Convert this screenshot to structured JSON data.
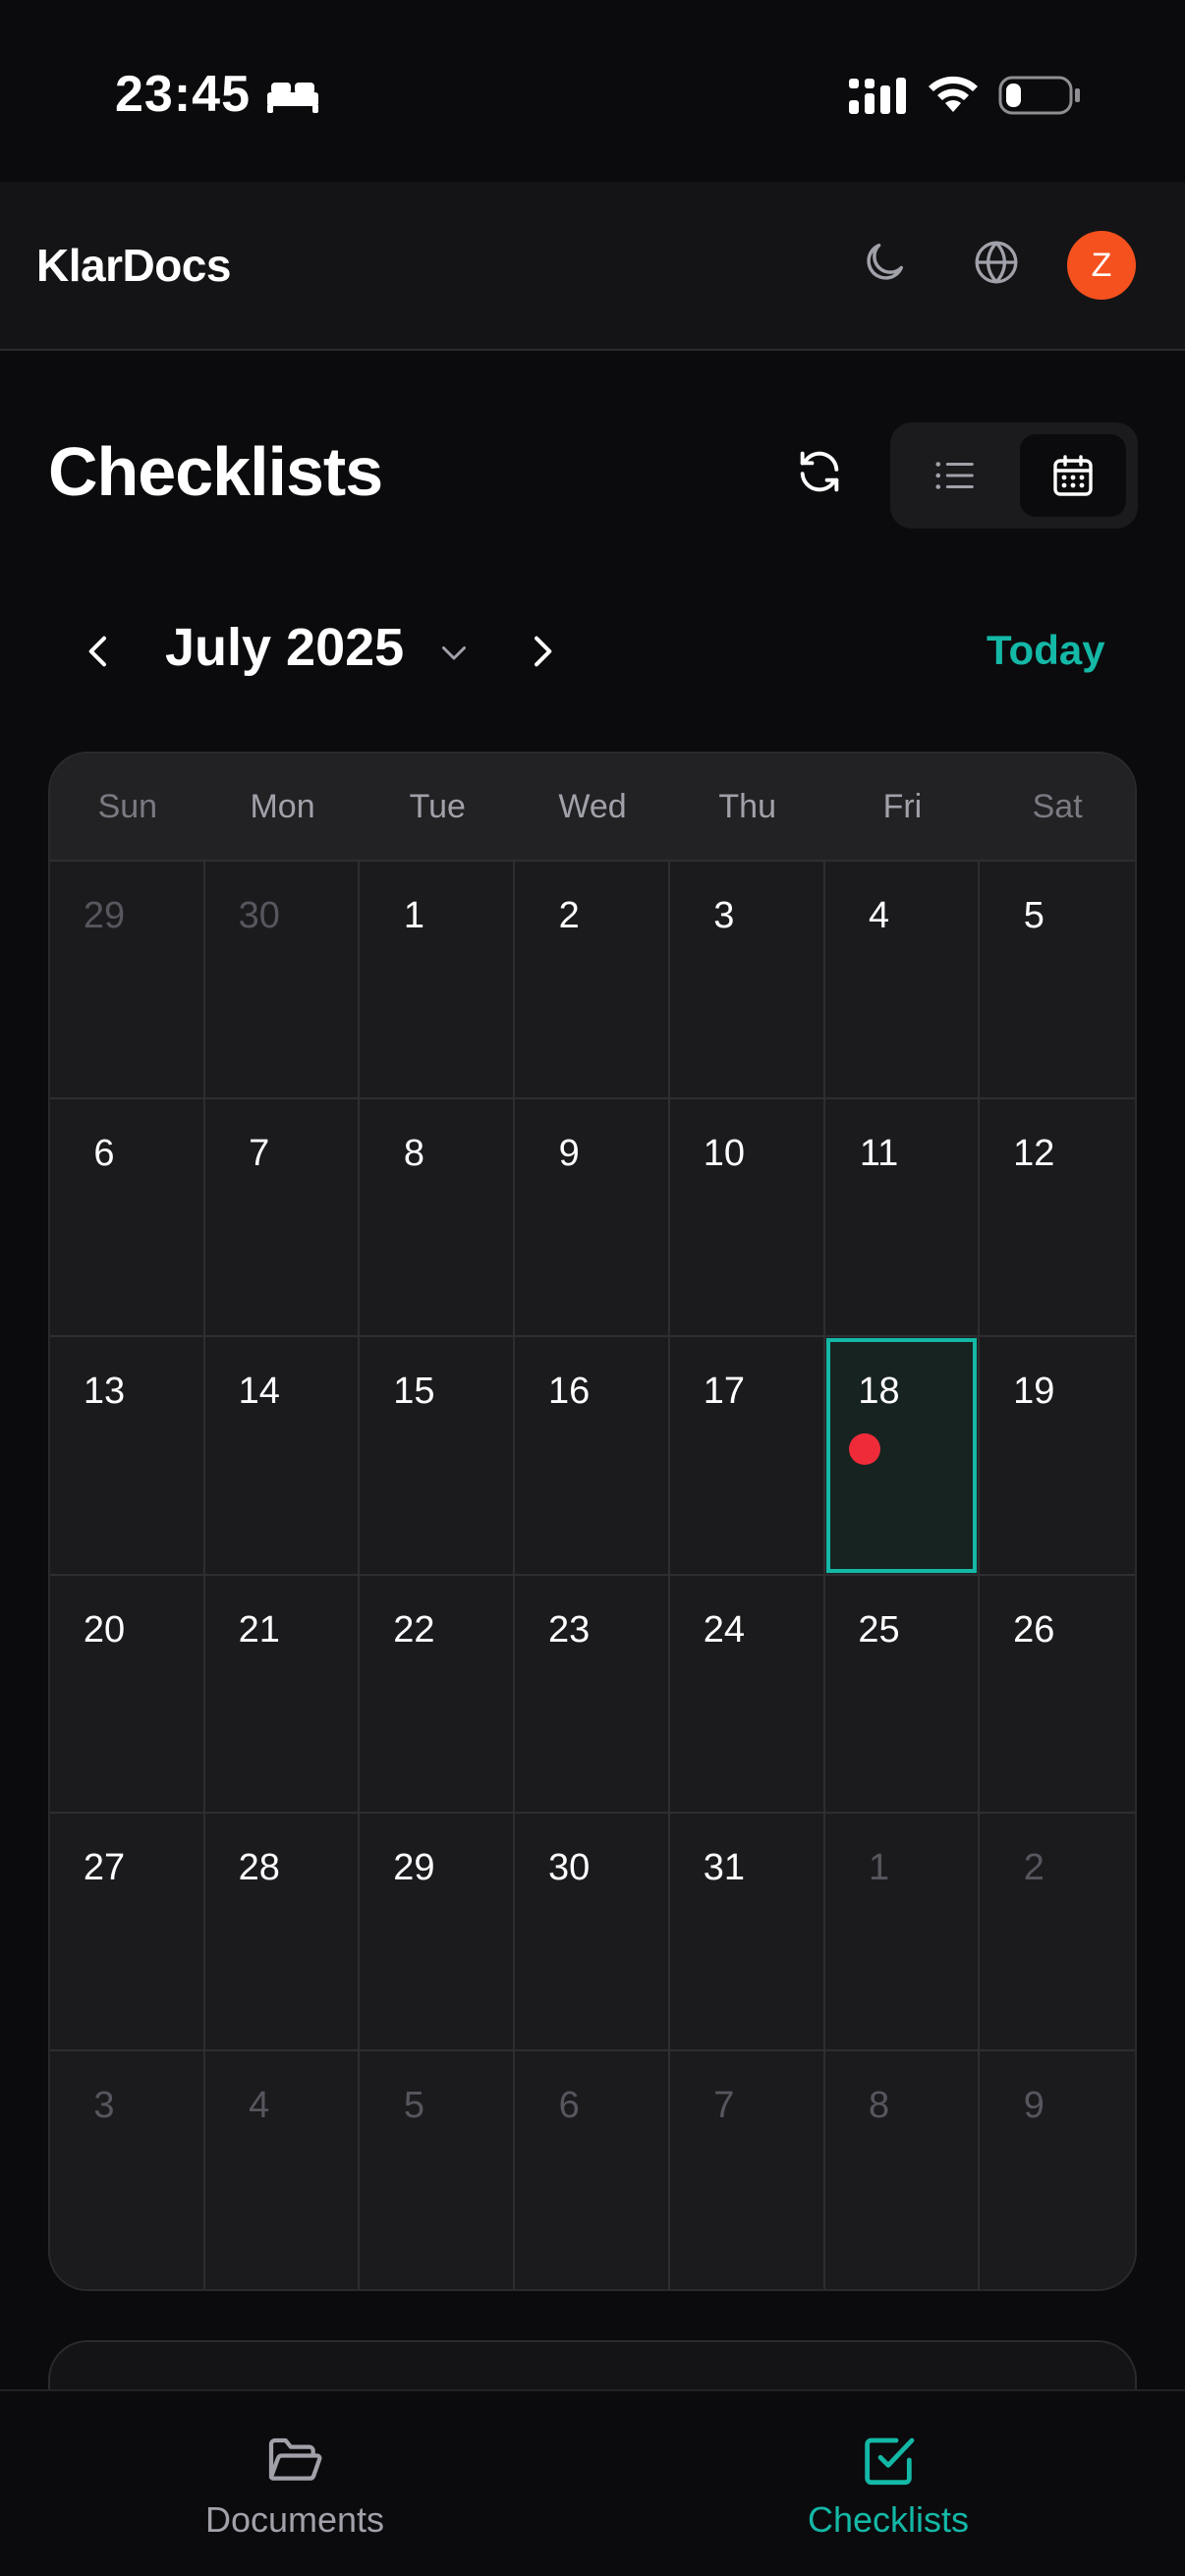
{
  "status_bar": {
    "time": "23:45",
    "icons": [
      "sleep-icon",
      "cellular-signal-icon",
      "wifi-icon",
      "battery-icon"
    ],
    "battery_level": 0.25
  },
  "header": {
    "title": "KlarDocs",
    "avatar_initial": "Z",
    "avatar_color": "#f4511e",
    "icons": [
      "moon-icon",
      "globe-icon"
    ]
  },
  "page": {
    "title": "Checklists",
    "view_mode": "calendar",
    "icons": [
      "refresh-icon",
      "list-view-icon",
      "calendar-view-icon"
    ]
  },
  "month_nav": {
    "month_label": "July 2025",
    "today_label": "Today",
    "accent": "#14b8a6"
  },
  "calendar": {
    "weekdays": [
      "Sun",
      "Mon",
      "Tue",
      "Wed",
      "Thu",
      "Fri",
      "Sat"
    ],
    "days": [
      {
        "n": "29",
        "current": false
      },
      {
        "n": "30",
        "current": false
      },
      {
        "n": "1",
        "current": true
      },
      {
        "n": "2",
        "current": true
      },
      {
        "n": "3",
        "current": true
      },
      {
        "n": "4",
        "current": true
      },
      {
        "n": "5",
        "current": true
      },
      {
        "n": "6",
        "current": true
      },
      {
        "n": "7",
        "current": true
      },
      {
        "n": "8",
        "current": true
      },
      {
        "n": "9",
        "current": true
      },
      {
        "n": "10",
        "current": true
      },
      {
        "n": "11",
        "current": true
      },
      {
        "n": "12",
        "current": true
      },
      {
        "n": "13",
        "current": true
      },
      {
        "n": "14",
        "current": true
      },
      {
        "n": "15",
        "current": true
      },
      {
        "n": "16",
        "current": true
      },
      {
        "n": "17",
        "current": true
      },
      {
        "n": "18",
        "current": true,
        "selected": true,
        "event": true
      },
      {
        "n": "19",
        "current": true
      },
      {
        "n": "20",
        "current": true
      },
      {
        "n": "21",
        "current": true
      },
      {
        "n": "22",
        "current": true
      },
      {
        "n": "23",
        "current": true
      },
      {
        "n": "24",
        "current": true
      },
      {
        "n": "25",
        "current": true
      },
      {
        "n": "26",
        "current": true
      },
      {
        "n": "27",
        "current": true
      },
      {
        "n": "28",
        "current": true
      },
      {
        "n": "29",
        "current": true
      },
      {
        "n": "30",
        "current": true
      },
      {
        "n": "31",
        "current": true
      },
      {
        "n": "1",
        "current": false
      },
      {
        "n": "2",
        "current": false
      },
      {
        "n": "3",
        "current": false
      },
      {
        "n": "4",
        "current": false
      },
      {
        "n": "5",
        "current": false
      },
      {
        "n": "6",
        "current": false
      },
      {
        "n": "7",
        "current": false
      },
      {
        "n": "8",
        "current": false
      },
      {
        "n": "9",
        "current": false
      }
    ],
    "event_dot_color": "#ef2b3a"
  },
  "bottom_nav": {
    "tabs": [
      {
        "label": "Documents",
        "icon": "folder-open-icon",
        "active": false
      },
      {
        "label": "Checklists",
        "icon": "checkbox-icon",
        "active": true
      }
    ]
  }
}
